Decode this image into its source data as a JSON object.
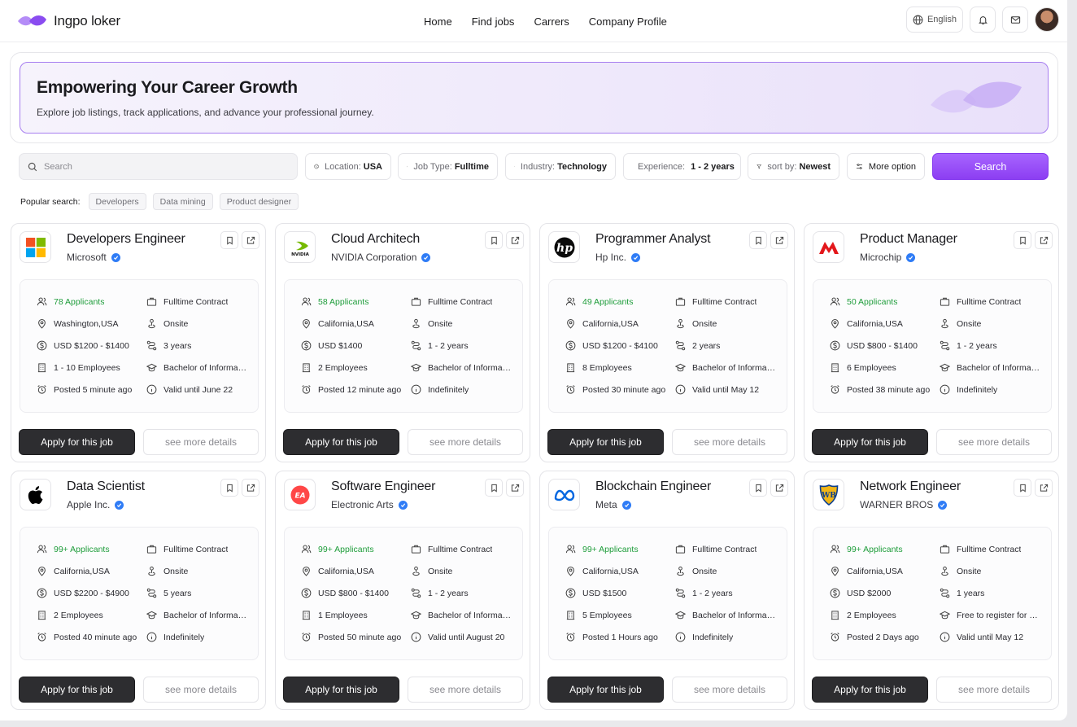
{
  "brand": {
    "name": "Ingpo loker"
  },
  "nav": {
    "links": [
      "Home",
      "Find jobs",
      "Carrers",
      "Company Profile"
    ],
    "language": "English"
  },
  "hero": {
    "title": "Empowering Your Career Growth",
    "subtitle": "Explore job listings, track applications, and advance your professional journey."
  },
  "filters": {
    "search_placeholder": "Search",
    "location": {
      "label": "Location:",
      "value": "USA"
    },
    "job_type": {
      "label": "Job Type:",
      "value": "Fulltime"
    },
    "industry": {
      "label": "Industry:",
      "value": "Technology"
    },
    "experience": {
      "label": "Experience:",
      "value": "1 - 2 years"
    },
    "sort": {
      "label": "sort by:",
      "value": "Newest"
    },
    "more": "More option",
    "search_button": "Search"
  },
  "popular": {
    "label": "Popular search:",
    "items": [
      "Developers",
      "Data mining",
      "Product designer"
    ]
  },
  "buttons": {
    "apply": "Apply for this job",
    "details": "see more details"
  },
  "colors": {
    "accent": "#9b4dff",
    "applicants": "#1f9d3b",
    "verified": "#2f7cf6",
    "apply_bg": "#2d2d30"
  },
  "jobs": [
    {
      "title": "Developers Engineer",
      "company": "Microsoft",
      "logo": "microsoft-logo",
      "applicants": "78 Applicants",
      "contract": "Fulltime Contract",
      "location": "Washington,USA",
      "work": "Onsite",
      "salary": "USD $1200 - $1400",
      "experience": "3 years",
      "employees": "1 - 10 Employees",
      "education": "Bachelor of Informati...",
      "posted": "Posted 5 minute ago",
      "valid": "Valid until June 22"
    },
    {
      "title": "Cloud Architech",
      "company": "NVIDIA Corporation",
      "logo": "nvidia-logo",
      "applicants": "58 Applicants",
      "contract": "Fulltime Contract",
      "location": "California,USA",
      "work": "Onsite",
      "salary": "USD $1400",
      "experience": "1 - 2 years",
      "employees": "2 Employees",
      "education": "Bachelor of Informati...",
      "posted": "Posted 12 minute ago",
      "valid": "Indefinitely"
    },
    {
      "title": "Programmer Analyst",
      "company": "Hp Inc.",
      "logo": "hp-logo",
      "applicants": "49 Applicants",
      "contract": "Fulltime Contract",
      "location": "California,USA",
      "work": "Onsite",
      "salary": "USD $1200 - $4100",
      "experience": "2 years",
      "employees": "8 Employees",
      "education": "Bachelor of Informati...",
      "posted": "Posted 30 minute ago",
      "valid": "Valid until May 12"
    },
    {
      "title": "Product Manager",
      "company": "Microchip",
      "logo": "microchip-logo",
      "applicants": "50 Applicants",
      "contract": "Fulltime Contract",
      "location": "California,USA",
      "work": "Onsite",
      "salary": "USD $800 - $1400",
      "experience": "1 - 2 years",
      "employees": "6 Employees",
      "education": "Bachelor of Informati...",
      "posted": "Posted 38 minute ago",
      "valid": "Indefinitely"
    },
    {
      "title": "Data Scientist",
      "company": "Apple Inc.",
      "logo": "apple-logo",
      "applicants": "99+ Applicants",
      "contract": "Fulltime Contract",
      "location": "California,USA",
      "work": "Onsite",
      "salary": "USD $2200 - $4900",
      "experience": "5 years",
      "employees": "2 Employees",
      "education": "Bachelor of Informati...",
      "posted": "Posted 40 minute ago",
      "valid": "Indefinitely"
    },
    {
      "title": "Software Engineer",
      "company": "Electronic Arts",
      "logo": "ea-logo",
      "applicants": "99+ Applicants",
      "contract": "Fulltime Contract",
      "location": "California,USA",
      "work": "Onsite",
      "salary": "USD $800 - $1400",
      "experience": "1 - 2 years",
      "employees": "1 Employees",
      "education": "Bachelor of Informati...",
      "posted": "Posted 50 minute ago",
      "valid": "Valid until August 20"
    },
    {
      "title": "Blockchain Engineer",
      "company": "Meta",
      "logo": "meta-logo",
      "applicants": "99+ Applicants",
      "contract": "Fulltime Contract",
      "location": "California,USA",
      "work": "Onsite",
      "salary": "USD $1500",
      "experience": "1 - 2 years",
      "employees": "5 Employees",
      "education": "Bachelor of Informati...",
      "posted": "Posted 1 Hours ago",
      "valid": "Indefinitely"
    },
    {
      "title": "Network Engineer",
      "company": "WARNER BROS",
      "logo": "warner-bros-logo",
      "applicants": "99+ Applicants",
      "contract": "Fulltime Contract",
      "location": "California,USA",
      "work": "Onsite",
      "salary": "USD $2000",
      "experience": "1 years",
      "employees": "2 Employees",
      "education": "Free to register for all...",
      "posted": "Posted 2 Days ago",
      "valid": "Valid until May 12"
    }
  ]
}
